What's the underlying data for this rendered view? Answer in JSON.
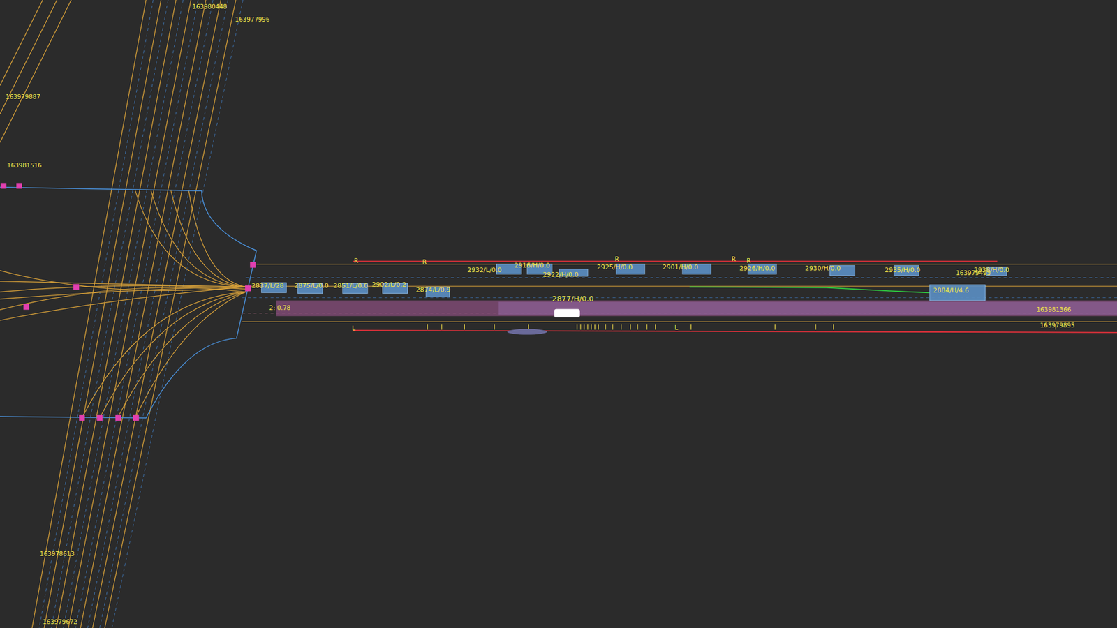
{
  "scene": {
    "lane_ids": [
      "163980448",
      "163977996",
      "163979887",
      "163981516",
      "163978613",
      "163979672",
      "163981366",
      "163979895",
      "163979493"
    ],
    "obstacles": [
      {
        "label": "2837/L/28"
      },
      {
        "label": "2875/L/0.0"
      },
      {
        "label": "2851/L/0.0"
      },
      {
        "label": "2902/L/0.2"
      },
      {
        "label": "2874/L/0.9"
      },
      {
        "label": "2932/L/0.0"
      },
      {
        "label": "2916/H/0.0"
      },
      {
        "label": "2922/H/0.0"
      },
      {
        "label": "2925/H/0.0"
      },
      {
        "label": "2901/H/0.0"
      },
      {
        "label": "2926/H/0.0"
      },
      {
        "label": "2930/H/0.0"
      },
      {
        "label": "2935/H/0.0"
      },
      {
        "label": "2884/H/4.6"
      },
      {
        "label": "2938/H/0.0"
      }
    ],
    "ego": {
      "label": "2877/H/0.0",
      "path_label": "2: 0.78"
    },
    "markers": [
      "R",
      "R",
      "R",
      "R",
      "R"
    ],
    "curb_marks": [
      "L",
      "L"
    ]
  }
}
